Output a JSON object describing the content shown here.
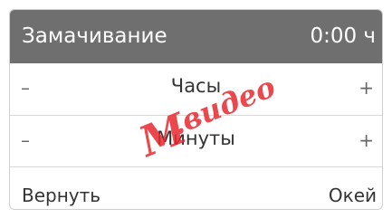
{
  "header": {
    "title": "Замачивание",
    "value": "0:00 ч"
  },
  "rows": [
    {
      "label": "Часы",
      "minus": "–",
      "plus": "+"
    },
    {
      "label": "Минуты",
      "minus": "–",
      "plus": "+"
    }
  ],
  "footer": {
    "back_label": "Вернуть",
    "ok_label": "Окей"
  },
  "watermark": {
    "text": "М.видео",
    "color": "#e8282f"
  },
  "colors": {
    "header_bg": "#6f6f6f",
    "header_text": "#ffffff"
  }
}
